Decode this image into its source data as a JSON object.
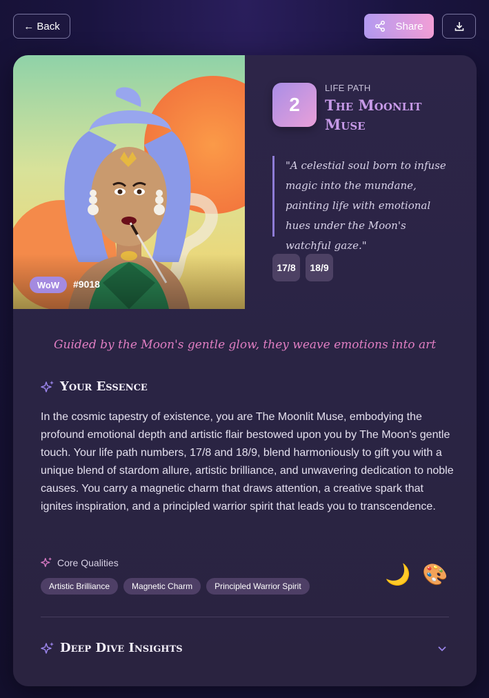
{
  "header": {
    "back_label": "← Back",
    "share_label": "Share",
    "share_icon": "share-icon",
    "download_icon": "download-icon"
  },
  "art": {
    "badge": "WoW",
    "token_id": "#9018"
  },
  "life_path": {
    "number": "2",
    "label": "LIFE PATH",
    "title": "The Moonlit Muse",
    "quote": "\"A celestial soul born to infuse magic into the mundane, painting life with emotional hues under the Moon's watchful gaze.\"",
    "numbers": [
      "17/8",
      "18/9"
    ]
  },
  "tagline": "Guided by the Moon's gentle glow, they weave emotions into art",
  "essence": {
    "heading": "Your Essence",
    "text": "In the cosmic tapestry of existence, you are The Moonlit Muse, embodying the profound emotional depth and artistic flair bestowed upon you by The Moon's gentle touch. Your life path numbers, 17/8 and 18/9, blend harmoniously to gift you with a unique blend of stardom allure, artistic brilliance, and unwavering dedication to noble causes. You carry a magnetic charm that draws attention, a creative spark that ignites inspiration, and a principled warrior spirit that leads you to transcendence."
  },
  "core_qualities": {
    "heading": "Core Qualities",
    "items": [
      "Artistic Brilliance",
      "Magnetic Charm",
      "Principled Warrior Spirit"
    ],
    "emojis": [
      "🌙",
      "🎨"
    ]
  },
  "deep_dive": {
    "heading": "Deep Dive Insights"
  },
  "colors": {
    "accent_gradient_start": "#b39af0",
    "accent_gradient_end": "#f29ed6",
    "title": "#c79ae8",
    "tagline": "#e07ec2",
    "sparkle": "#9a84ea"
  }
}
